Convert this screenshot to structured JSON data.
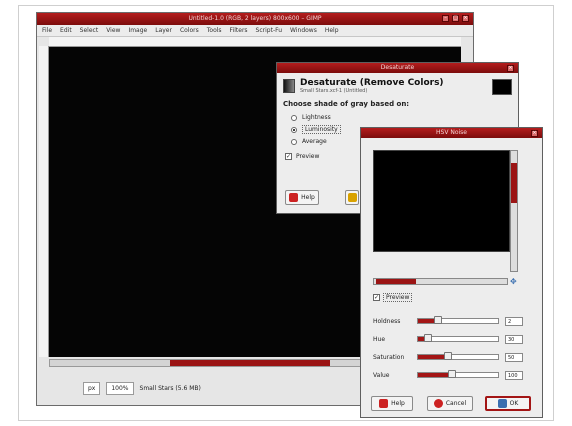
{
  "main": {
    "title": "Untitled-1.0 (RGB, 2 layers) 800x600 – GIMP",
    "menus": [
      "File",
      "Edit",
      "Select",
      "View",
      "Image",
      "Layer",
      "Colors",
      "Tools",
      "Filters",
      "Script-Fu",
      "Windows",
      "Help"
    ],
    "status": {
      "unit": "px",
      "zoom": "100%",
      "info": "Small Stars (5.6 MB)"
    }
  },
  "desaturate": {
    "title": "Desaturate",
    "heading": "Desaturate (Remove Colors)",
    "subheading": "Small Stars.xcf-1 (Untitled)",
    "group_label": "Choose shade of gray based on:",
    "options": [
      "Lightness",
      "Luminosity",
      "Average"
    ],
    "preview_label": "Preview",
    "help_label": "Help"
  },
  "hsv": {
    "title": "HSV Noise",
    "preview_label": "Preview",
    "sliders": [
      {
        "label": "Holdness",
        "value": "2",
        "fraction": 0.25
      },
      {
        "label": "Hue",
        "value": "30",
        "fraction": 0.12
      },
      {
        "label": "Saturation",
        "value": "50",
        "fraction": 0.38
      },
      {
        "label": "Value",
        "value": "100",
        "fraction": 0.42
      }
    ],
    "buttons": {
      "help": "Help",
      "cancel": "Cancel",
      "ok": "OK"
    }
  }
}
